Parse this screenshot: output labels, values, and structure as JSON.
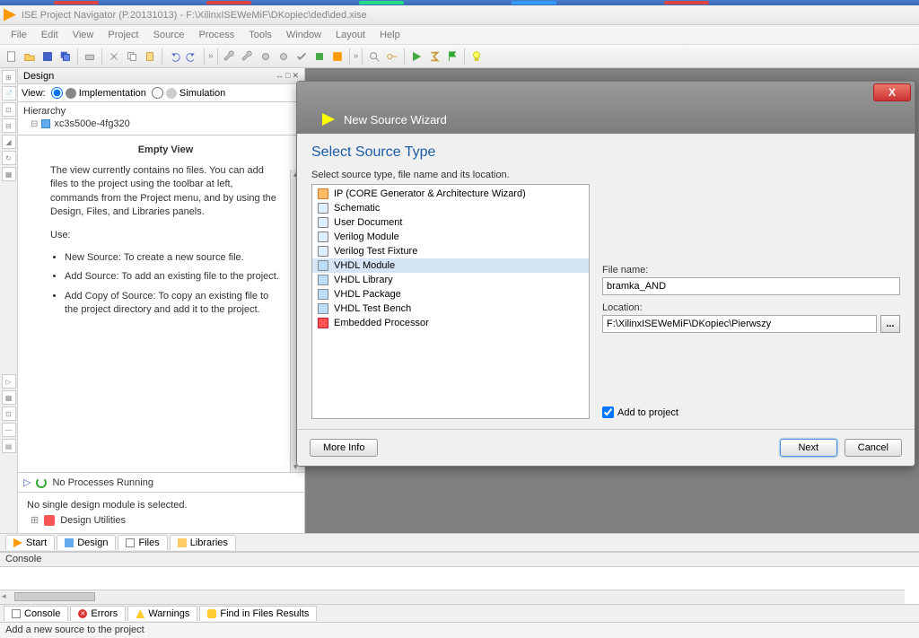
{
  "title": "ISE Project Navigator (P.20131013) - F:\\XilinxISEWeMiF\\DKopiec\\ded\\ded.xise",
  "menu": [
    "File",
    "Edit",
    "View",
    "Project",
    "Source",
    "Process",
    "Tools",
    "Window",
    "Layout",
    "Help"
  ],
  "design_panel": {
    "title": "Design",
    "view_label": "View:",
    "impl": "Implementation",
    "sim": "Simulation",
    "hierarchy": "Hierarchy",
    "device": "xc3s500e-4fg320",
    "empty_title": "Empty View",
    "empty_p": "The view currently contains no files. You can add files to the project using the toolbar at left, commands from the Project menu, and by using the Design, Files, and Libraries panels.",
    "use": "Use:",
    "b1": "New Source: To create a new source file.",
    "b2": "Add Source: To add an existing file to the project.",
    "b3": "Add Copy of Source: To copy an existing file to the project directory and add it to the project."
  },
  "proc": {
    "no_running": "No Processes Running",
    "no_module": "No single design module is selected.",
    "design_utilities": "Design Utilities"
  },
  "bottom_tabs": [
    "Start",
    "Design",
    "Files",
    "Libraries"
  ],
  "console": {
    "header": "Console",
    "tabs": [
      "Console",
      "Errors",
      "Warnings",
      "Find in Files Results"
    ]
  },
  "status": "Add a new source to the project",
  "wizard": {
    "title": "New Source Wizard",
    "heading": "Select Source Type",
    "sub": "Select source type, file name and its location.",
    "items": [
      "IP (CORE Generator & Architecture Wizard)",
      "Schematic",
      "User Document",
      "Verilog Module",
      "Verilog Test Fixture",
      "VHDL Module",
      "VHDL Library",
      "VHDL Package",
      "VHDL Test Bench",
      "Embedded Processor"
    ],
    "selected_index": 5,
    "file_label": "File name:",
    "file_value": "bramka_AND",
    "loc_label": "Location:",
    "loc_value": "F:\\XilinxISEWeMiF\\DKopiec\\Pierwszy",
    "add_label": "Add to project",
    "more_info": "More Info",
    "next": "Next",
    "cancel": "Cancel"
  }
}
